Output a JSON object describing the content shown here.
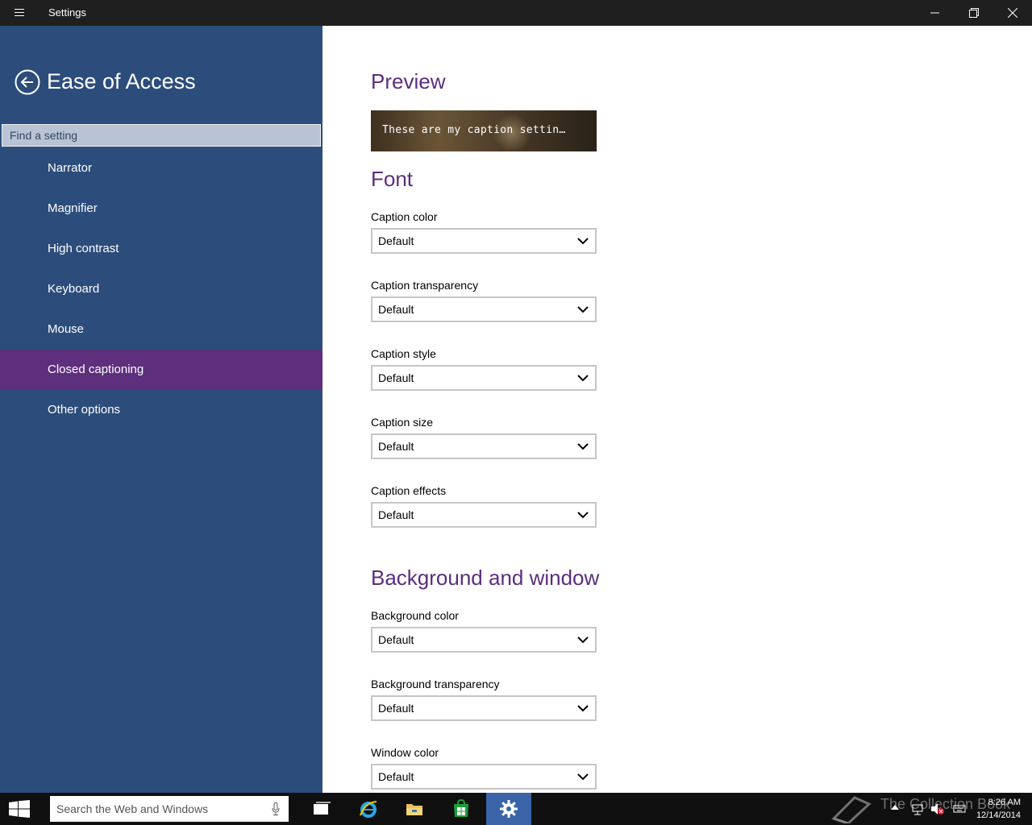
{
  "titlebar": {
    "title": "Settings"
  },
  "sidebar": {
    "section_title": "Ease of Access",
    "search_placeholder": "Find a setting",
    "items": [
      {
        "label": "Narrator"
      },
      {
        "label": "Magnifier"
      },
      {
        "label": "High contrast"
      },
      {
        "label": "Keyboard"
      },
      {
        "label": "Mouse"
      },
      {
        "label": "Closed captioning",
        "active": true
      },
      {
        "label": "Other options"
      }
    ]
  },
  "main": {
    "preview_heading": "Preview",
    "preview_text": "These are my caption settin…",
    "font_heading": "Font",
    "font_fields": [
      {
        "label": "Caption color",
        "value": "Default"
      },
      {
        "label": "Caption transparency",
        "value": "Default"
      },
      {
        "label": "Caption style",
        "value": "Default"
      },
      {
        "label": "Caption size",
        "value": "Default"
      },
      {
        "label": "Caption effects",
        "value": "Default"
      }
    ],
    "background_heading": "Background and window",
    "background_fields": [
      {
        "label": "Background color",
        "value": "Default"
      },
      {
        "label": "Background transparency",
        "value": "Default"
      },
      {
        "label": "Window color",
        "value": "Default"
      }
    ]
  },
  "taskbar": {
    "search_placeholder": "Search the Web and Windows",
    "watermark": "The Collection Book",
    "time": "8:26 AM",
    "date": "12/14/2014"
  },
  "colors": {
    "sidebar_bg": "#2c4d7b",
    "active_item": "#5e2f7d",
    "heading": "#5c2d7e",
    "taskbar_active": "#3b64a8"
  }
}
